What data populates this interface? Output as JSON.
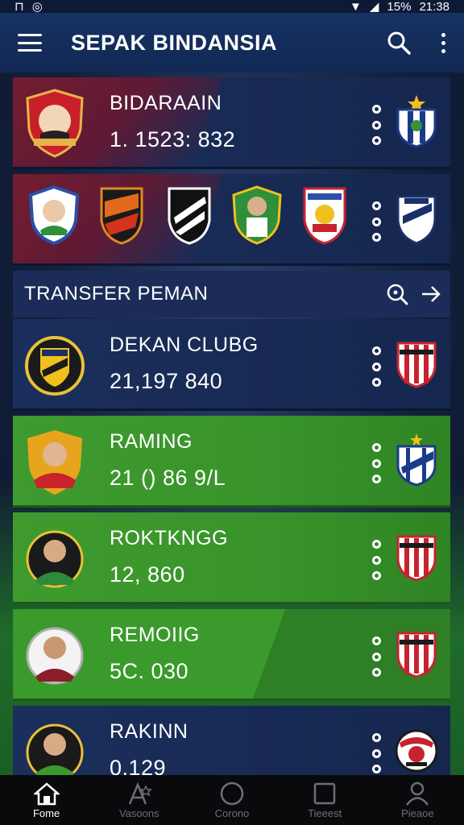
{
  "statusbar": {
    "battery": "15%",
    "time": "21:38"
  },
  "appbar": {
    "title": "SEPAK BINDANSIA"
  },
  "cards_top": [
    {
      "name": "BIDARAAIN",
      "value": "1. 1523: 832"
    }
  ],
  "section": {
    "label": "TRANSFER PEMAN"
  },
  "cards": [
    {
      "name": "DEKAN CLUBG",
      "value": "21,197 840"
    },
    {
      "name": "RAMING",
      "value": "21 () 86 9/L"
    },
    {
      "name": "ROKTKNGG",
      "value": "12, 860"
    },
    {
      "name": "REMOIIG",
      "value": "5C. 030"
    },
    {
      "name": "RAKINN",
      "value": "0.129"
    }
  ],
  "bottomnav": [
    {
      "label": "Fome",
      "icon": "home-icon",
      "active": true
    },
    {
      "label": "Vasoons",
      "icon": "star-icon",
      "active": false
    },
    {
      "label": "Corono",
      "icon": "circle-icon",
      "active": false
    },
    {
      "label": "Tieeest",
      "icon": "square-icon",
      "active": false
    },
    {
      "label": "Pieaoe",
      "icon": "profile-icon",
      "active": false
    }
  ],
  "colors": {
    "appbar": "#173263",
    "green_card": "#3f9b2e",
    "red_accent": "#7a1d2e",
    "nav_bg": "#0a0a0c"
  }
}
